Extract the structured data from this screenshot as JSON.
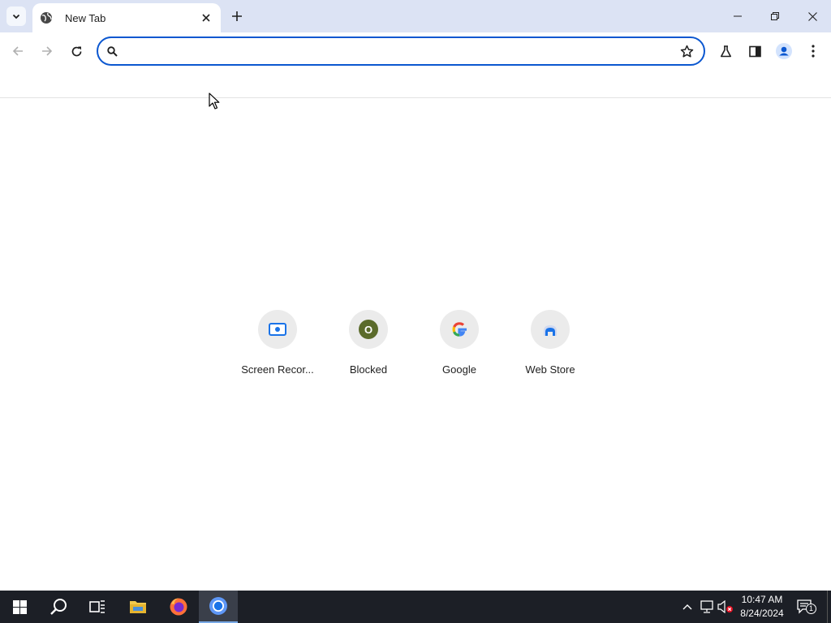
{
  "browser": {
    "tab": {
      "title": "New Tab"
    },
    "omnibox": {
      "value": "",
      "placeholder": ""
    }
  },
  "shortcuts": [
    {
      "label": "Screen Recor...",
      "icon": "screen-recorder-icon"
    },
    {
      "label": "Blocked",
      "icon": "letter-o-icon",
      "letter": "O"
    },
    {
      "label": "Google",
      "icon": "google-g-icon"
    },
    {
      "label": "Web Store",
      "icon": "web-store-icon"
    }
  ],
  "taskbar": {
    "time": "10:47 AM",
    "date": "8/24/2024",
    "notification_count": "1"
  },
  "colors": {
    "tabstrip": "#dce3f4",
    "accent": "#0b57d0",
    "taskbar": "#1c1f26"
  }
}
